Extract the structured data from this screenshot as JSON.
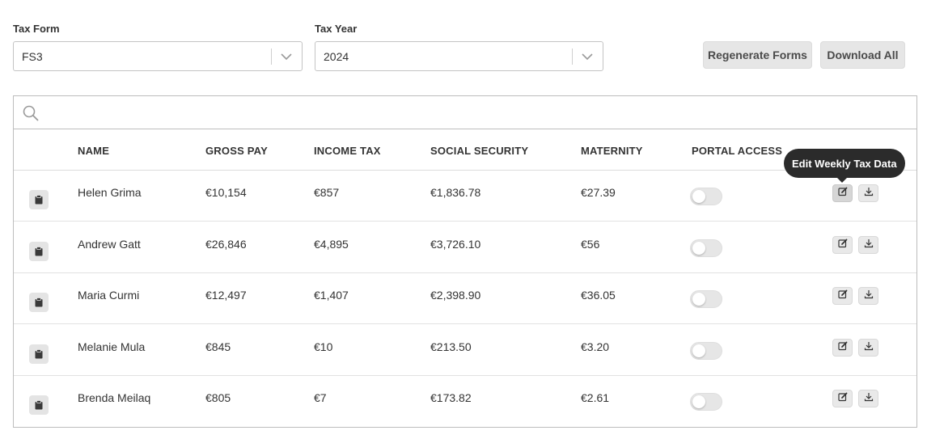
{
  "filters": {
    "tax_form": {
      "label": "Tax Form",
      "value": "FS3"
    },
    "tax_year": {
      "label": "Tax Year",
      "value": "2024"
    }
  },
  "actions": {
    "regenerate_label": "Regenerate Forms",
    "download_all_label": "Download All"
  },
  "search": {
    "placeholder": ""
  },
  "table": {
    "columns": {
      "name": "NAME",
      "gross_pay": "GROSS PAY",
      "income_tax": "INCOME TAX",
      "social_security": "SOCIAL SECURITY",
      "maternity": "MATERNITY",
      "portal_access": "PORTAL ACCESS"
    },
    "rows": [
      {
        "name": "Helen Grima",
        "gross_pay": "€10,154",
        "income_tax": "€857",
        "social_security": "€1,836.78",
        "maternity": "€27.39",
        "portal_access": false
      },
      {
        "name": "Andrew Gatt",
        "gross_pay": "€26,846",
        "income_tax": "€4,895",
        "social_security": "€3,726.10",
        "maternity": "€56",
        "portal_access": false
      },
      {
        "name": "Maria Curmi",
        "gross_pay": "€12,497",
        "income_tax": "€1,407",
        "social_security": "€2,398.90",
        "maternity": "€36.05",
        "portal_access": false
      },
      {
        "name": "Melanie Mula",
        "gross_pay": "€845",
        "income_tax": "€10",
        "social_security": "€213.50",
        "maternity": "€3.20",
        "portal_access": false
      },
      {
        "name": "Brenda Meilaq",
        "gross_pay": "€805",
        "income_tax": "€7",
        "social_security": "€173.82",
        "maternity": "€2.61",
        "portal_access": false
      }
    ]
  },
  "tooltip": {
    "text": "Edit Weekly Tax Data"
  },
  "icons": {
    "row_leading": "clipboard-icon",
    "edit": "edit-icon",
    "download": "download-icon",
    "search": "search-icon",
    "chevron": "chevron-down-icon"
  }
}
